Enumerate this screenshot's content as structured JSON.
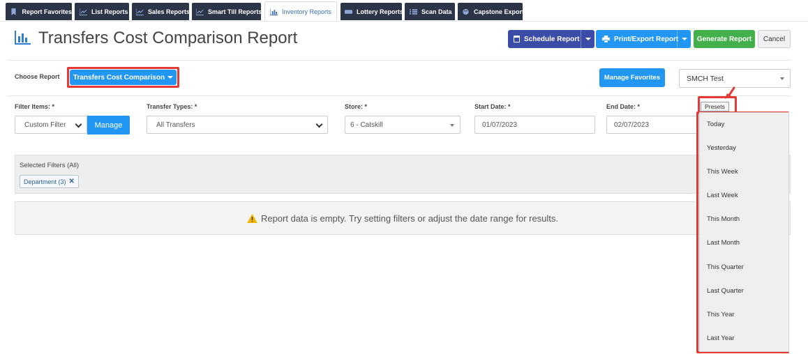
{
  "tabs": [
    {
      "label": "Report Favorites",
      "icon": "bookmark-icon"
    },
    {
      "label": "List Reports",
      "icon": "line-chart-icon"
    },
    {
      "label": "Sales Reports",
      "icon": "line-chart-icon"
    },
    {
      "label": "Smart Till Reports",
      "icon": "line-chart-icon"
    },
    {
      "label": "Inventory Reports",
      "icon": "bar-chart-icon",
      "active": true
    },
    {
      "label": "Lottery Reports",
      "icon": "ticket-icon"
    },
    {
      "label": "Scan Data",
      "icon": "list-icon"
    },
    {
      "label": "Capstone Export",
      "icon": "palette-icon"
    }
  ],
  "header": {
    "title": "Transfers Cost Comparison Report",
    "schedule_label": "Schedule Report",
    "print_label": "Print/Export Report",
    "generate_label": "Generate Report",
    "cancel_label": "Cancel"
  },
  "choose": {
    "label": "Choose Report",
    "report_button": "Transfers Cost Comparison",
    "manage_favorites": "Manage Favorites",
    "profile_value": "SMCH Test"
  },
  "filters": {
    "filter_items_label": "Filter Items: *",
    "filter_items_value": "Custom Filter",
    "manage_label": "Manage",
    "transfer_types_label": "Transfer Types: *",
    "transfer_types_value": "All Transfers",
    "store_label": "Store: *",
    "store_value": "6 - Catskill",
    "start_date_label": "Start Date: *",
    "start_date_value": "01/07/2023",
    "end_date_label": "End Date: *",
    "end_date_value": "02/07/2023",
    "presets_label": "Presets"
  },
  "selected_filters": {
    "title": "Selected Filters (All)",
    "chips": [
      "Department (3)"
    ]
  },
  "empty_message": "Report data is empty. Try setting filters or adjust the date range for results.",
  "presets": [
    "Today",
    "Yesterday",
    "This Week",
    "Last Week",
    "This Month",
    "Last Month",
    "This Quarter",
    "Last Quarter",
    "This Year",
    "Last Year"
  ],
  "colors": {
    "tab_bg": "#2c3547",
    "navy_button": "#3b4ba8",
    "blue_button": "#2196f3",
    "green_button": "#43b14b",
    "highlight": "#e53935",
    "warning": "#f5b800"
  }
}
